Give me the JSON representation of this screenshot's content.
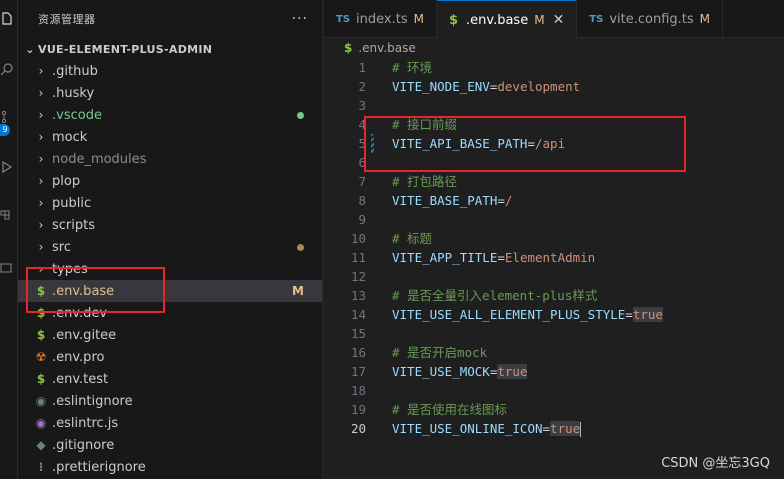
{
  "activity_bar": {
    "icons": [
      "explorer-icon",
      "search-icon",
      "source-control-icon",
      "run-debug-icon",
      "extensions-icon",
      "remote-icon"
    ],
    "source_control_badge": "9"
  },
  "sidebar": {
    "title": "资源管理器",
    "more": "···",
    "project": "VUE-ELEMENT-PLUS-ADMIN",
    "items": [
      {
        "label": ".github",
        "type": "folder"
      },
      {
        "label": ".husky",
        "type": "folder"
      },
      {
        "label": ".vscode",
        "type": "folder",
        "dot_color": "#73c991",
        "label_color": "#73c991"
      },
      {
        "label": "mock",
        "type": "folder"
      },
      {
        "label": "node_modules",
        "type": "folder",
        "label_color": "#8c8c8c"
      },
      {
        "label": "plop",
        "type": "folder"
      },
      {
        "label": "public",
        "type": "folder"
      },
      {
        "label": "scripts",
        "type": "folder"
      },
      {
        "label": "src",
        "type": "folder",
        "dot_color": "#a68a5b"
      },
      {
        "label": "types",
        "type": "folder"
      },
      {
        "label": ".env.base",
        "type": "file",
        "icon": "$",
        "badge": "M",
        "selected": true,
        "label_color": "#e2c08d"
      },
      {
        "label": ".env.dev",
        "type": "file",
        "icon": "$"
      },
      {
        "label": ".env.gitee",
        "type": "file",
        "icon": "$"
      },
      {
        "label": ".env.pro",
        "type": "file",
        "icon": "☢"
      },
      {
        "label": ".env.test",
        "type": "file",
        "icon": "$"
      },
      {
        "label": ".eslintignore",
        "type": "file",
        "icon": "◉"
      },
      {
        "label": ".eslintrc.js",
        "type": "file",
        "icon": "◉"
      },
      {
        "label": ".gitignore",
        "type": "file",
        "icon": "◆"
      },
      {
        "label": ".prettierignore",
        "type": "file",
        "icon": "⁝"
      }
    ]
  },
  "tabs": [
    {
      "label": "index.ts",
      "icon": "TS",
      "modified": "M",
      "active": false
    },
    {
      "label": ".env.base",
      "icon": "$",
      "modified": "M",
      "active": true,
      "close": "✕"
    },
    {
      "label": "vite.config.ts",
      "icon": "TS",
      "modified": "M",
      "active": false
    }
  ],
  "breadcrumb": {
    "icon": "$",
    "file": ".env.base"
  },
  "editor": {
    "current_line": 20,
    "lines": [
      {
        "n": "1",
        "tokens": [
          {
            "t": "comment",
            "v": "# 环境"
          }
        ]
      },
      {
        "n": "2",
        "tokens": [
          {
            "t": "key",
            "v": "VITE_NODE_ENV"
          },
          {
            "t": "op",
            "v": "="
          },
          {
            "t": "val",
            "v": "development"
          }
        ]
      },
      {
        "n": "3",
        "tokens": []
      },
      {
        "n": "4",
        "tokens": [
          {
            "t": "comment",
            "v": "# 接口前缀"
          }
        ]
      },
      {
        "n": "5",
        "tokens": [
          {
            "t": "key",
            "v": "VITE_API_BASE_PATH"
          },
          {
            "t": "op",
            "v": "="
          },
          {
            "t": "val",
            "v": "/api"
          }
        ],
        "modified": true
      },
      {
        "n": "6",
        "tokens": []
      },
      {
        "n": "7",
        "tokens": [
          {
            "t": "comment",
            "v": "# 打包路径"
          }
        ]
      },
      {
        "n": "8",
        "tokens": [
          {
            "t": "key",
            "v": "VITE_BASE_PATH"
          },
          {
            "t": "op",
            "v": "="
          },
          {
            "t": "val",
            "v": "/"
          }
        ]
      },
      {
        "n": "9",
        "tokens": []
      },
      {
        "n": "10",
        "tokens": [
          {
            "t": "comment",
            "v": "# 标题"
          }
        ]
      },
      {
        "n": "11",
        "tokens": [
          {
            "t": "key",
            "v": "VITE_APP_TITLE"
          },
          {
            "t": "op",
            "v": "="
          },
          {
            "t": "val",
            "v": "ElementAdmin"
          }
        ]
      },
      {
        "n": "12",
        "tokens": []
      },
      {
        "n": "13",
        "tokens": [
          {
            "t": "comment",
            "v": "# 是否全量引入element-plus样式"
          }
        ]
      },
      {
        "n": "14",
        "tokens": [
          {
            "t": "key",
            "v": "VITE_USE_ALL_ELEMENT_PLUS_STYLE"
          },
          {
            "t": "op",
            "v": "="
          },
          {
            "t": "bool",
            "v": "true"
          }
        ]
      },
      {
        "n": "15",
        "tokens": []
      },
      {
        "n": "16",
        "tokens": [
          {
            "t": "comment",
            "v": "# 是否开启mock"
          }
        ]
      },
      {
        "n": "17",
        "tokens": [
          {
            "t": "key",
            "v": "VITE_USE_MOCK"
          },
          {
            "t": "op",
            "v": "="
          },
          {
            "t": "bool",
            "v": "true"
          }
        ]
      },
      {
        "n": "18",
        "tokens": []
      },
      {
        "n": "19",
        "tokens": [
          {
            "t": "comment",
            "v": "# 是否使用在线图标"
          }
        ]
      },
      {
        "n": "20",
        "tokens": [
          {
            "t": "key",
            "v": "VITE_USE_ONLINE_ICON"
          },
          {
            "t": "op",
            "v": "="
          },
          {
            "t": "bool",
            "v": "true"
          }
        ],
        "cursor": true
      }
    ]
  },
  "watermark": "CSDN @坐忘3GQ"
}
